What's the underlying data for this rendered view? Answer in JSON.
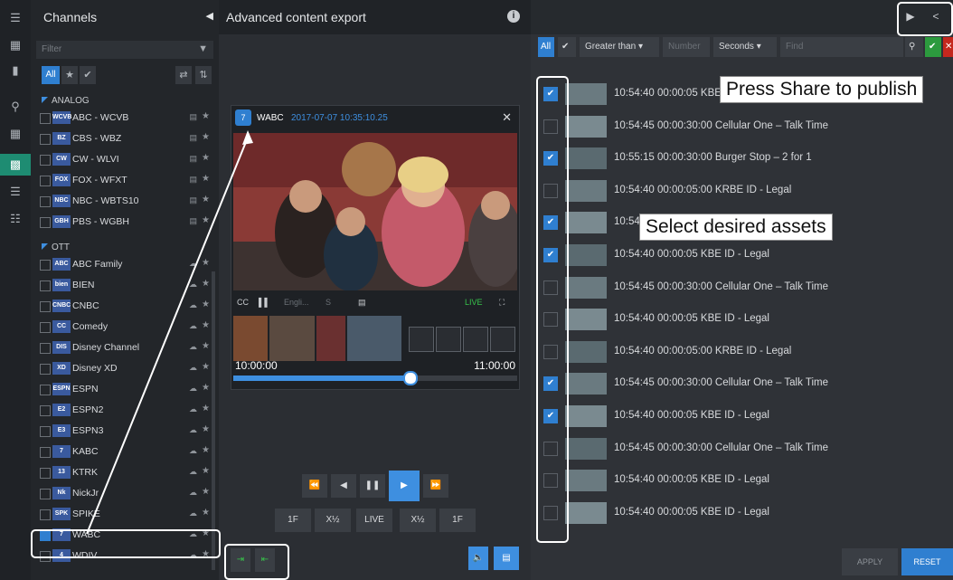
{
  "rail": {
    "icons": [
      "menu-icon",
      "film-icon",
      "bookmark-icon",
      "search-icon",
      "grid-icon",
      "monitor-icon",
      "list-icon",
      "table-icon"
    ],
    "active_index": 5
  },
  "channels": {
    "title": "Channels",
    "filter_placeholder": "Filter",
    "all_label": "All",
    "groups": [
      {
        "label": "ANALOG",
        "items": [
          {
            "name": "ABC - WCVB",
            "logo": "WCVB",
            "checked": false
          },
          {
            "name": "CBS - WBZ",
            "logo": "BZ",
            "checked": false
          },
          {
            "name": "CW - WLVI",
            "logo": "CW",
            "checked": false
          },
          {
            "name": "FOX - WFXT",
            "logo": "FOX",
            "checked": false
          },
          {
            "name": "NBC - WBTS10",
            "logo": "NBC",
            "checked": false
          },
          {
            "name": "PBS - WGBH",
            "logo": "GBH",
            "checked": false
          }
        ]
      },
      {
        "label": "OTT",
        "items": [
          {
            "name": "ABC Family",
            "logo": "ABC",
            "checked": false
          },
          {
            "name": "BIEN",
            "logo": "bien",
            "checked": false
          },
          {
            "name": "CNBC",
            "logo": "CNBC",
            "checked": false
          },
          {
            "name": "Comedy",
            "logo": "CC",
            "checked": false
          },
          {
            "name": "Disney Channel",
            "logo": "DIS",
            "checked": false
          },
          {
            "name": "Disney XD",
            "logo": "XD",
            "checked": false
          },
          {
            "name": "ESPN",
            "logo": "ESPN",
            "checked": false
          },
          {
            "name": "ESPN2",
            "logo": "E2",
            "checked": false
          },
          {
            "name": "ESPN3",
            "logo": "E3",
            "checked": false
          },
          {
            "name": "KABC",
            "logo": "7",
            "checked": false
          },
          {
            "name": "KTRK",
            "logo": "13",
            "checked": false
          },
          {
            "name": "NickJr",
            "logo": "Nk",
            "checked": false
          },
          {
            "name": "SPIKE",
            "logo": "SPK",
            "checked": false
          },
          {
            "name": "WABC",
            "logo": "7",
            "checked": true
          },
          {
            "name": "WDIV",
            "logo": "4",
            "checked": false
          }
        ]
      }
    ]
  },
  "middle": {
    "title": "Advanced content export",
    "player": {
      "channel": "WABC",
      "timestamp": "2017-07-07 10:35:10.25",
      "controls": [
        "CC",
        "Engli...",
        "S",
        "LIVE"
      ],
      "time_start": "10:00:00",
      "time_end": "11:00:00",
      "progress": 0.62
    },
    "transport_row1": [
      "rewind-icon",
      "step-back-icon",
      "pause-icon",
      "play-icon",
      "fast-forward-icon"
    ],
    "transport_row2": [
      "1F",
      "X½",
      "LIVE",
      "X½",
      "1F"
    ]
  },
  "filter": {
    "all_label": "All",
    "comparator": "Greater than",
    "number_placeholder": "Number",
    "unit": "Seconds",
    "find_placeholder": "Find"
  },
  "assets": [
    {
      "text": "10:54:40 00:00:05 KBE ID - Legal",
      "checked": true
    },
    {
      "text": "10:54:45 00:00:30:00 Cellular One – Talk Time",
      "checked": false
    },
    {
      "text": "10:55:15 00:00:30:00 Burger Stop – 2 for 1",
      "checked": true
    },
    {
      "text": "10:54:40 00:00:05:00 KRBE ID - Legal",
      "checked": false
    },
    {
      "text": "10:54:40 00:00:30:00 Cellular One – Talk Time",
      "checked": true
    },
    {
      "text": "10:54:40 00:00:05 KBE ID - Legal",
      "checked": true
    },
    {
      "text": "10:54:45 00:00:30:00 Cellular One – Talk Time",
      "checked": false
    },
    {
      "text": "10:54:40 00:00:05 KBE ID - Legal",
      "checked": false
    },
    {
      "text": "10:54:40 00:00:05:00 KRBE ID - Legal",
      "checked": false
    },
    {
      "text": "10:54:45 00:00:30:00 Cellular One – Talk Time",
      "checked": true
    },
    {
      "text": "10:54:40 00:00:05 KBE ID - Legal",
      "checked": true
    },
    {
      "text": "10:54:45 00:00:30:00 Cellular One – Talk Time",
      "checked": false
    },
    {
      "text": "10:54:40 00:00:05 KBE ID - Legal",
      "checked": false
    },
    {
      "text": "10:54:40 00:00:05 KBE ID - Legal",
      "checked": false
    }
  ],
  "buttons": {
    "apply": "APPLY",
    "reset": "RESET"
  },
  "callouts": {
    "share": "Press Share to publish",
    "select": "Select desired assets"
  },
  "colors": {
    "accent": "#2f7fd0",
    "active_rail": "#1e8c72",
    "live": "#37c24a"
  }
}
